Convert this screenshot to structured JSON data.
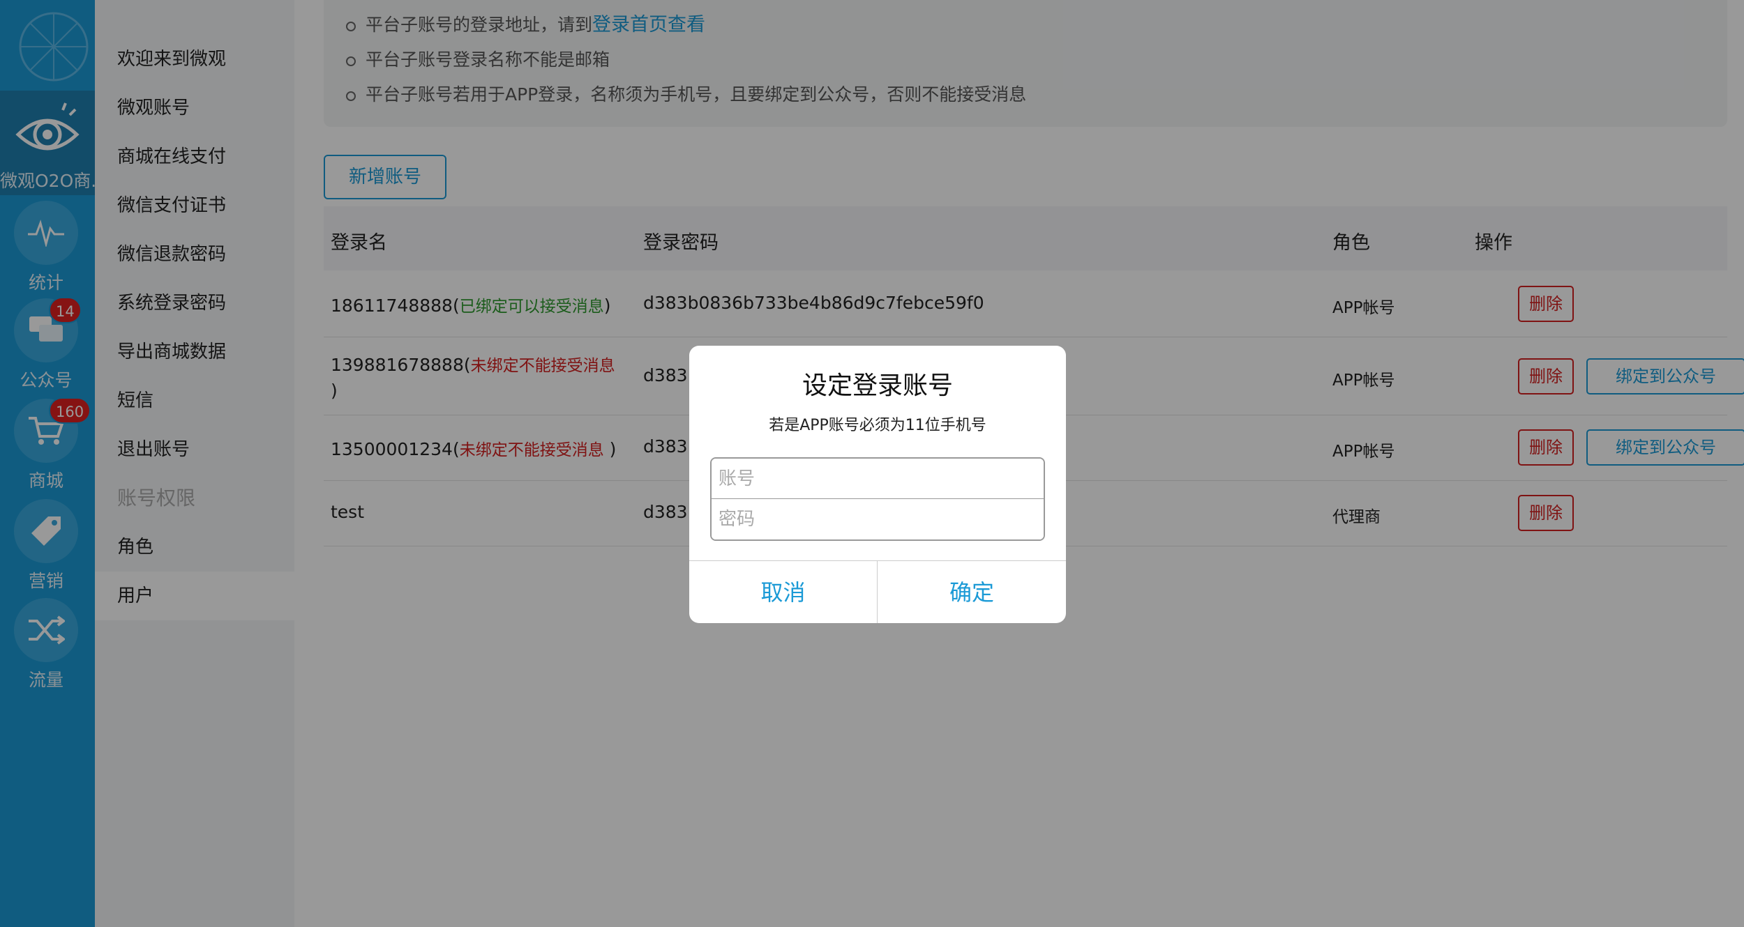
{
  "rail": {
    "app_label": "微观O2O商...",
    "items": [
      {
        "label": "统计",
        "icon": "pulse-icon"
      },
      {
        "label": "公众号",
        "icon": "chat-icon",
        "badge": "14"
      },
      {
        "label": "商城",
        "icon": "cart-icon",
        "badge": "160"
      },
      {
        "label": "营销",
        "icon": "tag-icon"
      },
      {
        "label": "流量",
        "icon": "shuffle-icon"
      }
    ]
  },
  "subnav": {
    "items": [
      "欢迎来到微观",
      "微观账号",
      "商城在线支付",
      "微信支付证书",
      "微信退款密码",
      "系统登录密码",
      "导出商城数据",
      "短信",
      "退出账号"
    ],
    "section_header": "账号权限",
    "section_items": [
      "角色",
      "用户"
    ],
    "active": "用户"
  },
  "notice": {
    "line1_prefix": "平台子账号的登录地址，请到",
    "line1_link": "登录首页查看",
    "line2": "平台子账号登录名称不能是邮箱",
    "line3": "平台子账号若用于APP登录，名称须为手机号，且要绑定到公众号，否则不能接受消息"
  },
  "add_button": "新增账号",
  "table": {
    "headers": [
      "登录名",
      "登录密码",
      "角色",
      "操作"
    ],
    "rows": [
      {
        "name": "18611748888(",
        "status": "已绑定可以接受消息",
        "status_type": "ok",
        "close": ")",
        "pwd": "d383b0836b733be4b86d9c7febce59f0",
        "role": "APP帐号",
        "delete": "删除",
        "bind": ""
      },
      {
        "name": "139881678888(",
        "status": "未绑定不能接受消息",
        "status_type": "bad",
        "close": ")",
        "pwd": "d383",
        "role": "APP帐号",
        "delete": "删除",
        "bind": "绑定到公众号"
      },
      {
        "name": "13500001234(",
        "status": "未绑定不能接受消息",
        "status_type": "bad",
        "close": " )",
        "pwd": "d383",
        "role": "APP帐号",
        "delete": "删除",
        "bind": "绑定到公众号"
      },
      {
        "name": "test",
        "status": "",
        "status_type": "",
        "close": "",
        "pwd": "d383",
        "role": "代理商",
        "delete": "删除",
        "bind": ""
      }
    ]
  },
  "dialog": {
    "title": "设定登录账号",
    "message": "若是APP账号必须为11位手机号",
    "account_placeholder": "账号",
    "account_value": "",
    "password_placeholder": "密码",
    "password_value": "",
    "cancel": "取消",
    "confirm": "确定"
  },
  "colors": {
    "accent": "#1b9ad6",
    "danger": "#d42020",
    "success": "#2e9a2e"
  }
}
